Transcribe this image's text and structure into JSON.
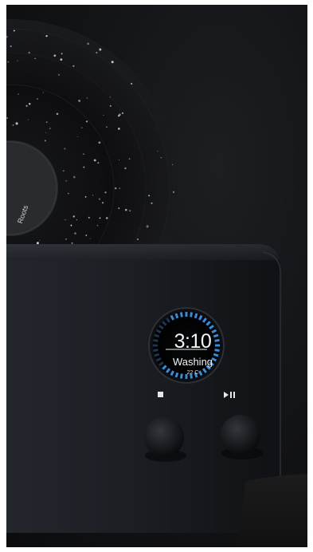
{
  "display": {
    "time": "3:10",
    "mode": "Washing",
    "temperature": "22 C",
    "progress_ring_color": "#2f8fe0",
    "progress_ring_dim_color": "#1d3550"
  },
  "record_label": {
    "artist_text": "Roots"
  },
  "controls": {
    "left_icon": "stop-icon",
    "right_icon": "play-pause-icon"
  },
  "colors": {
    "background": "#121315",
    "device_body": "#1a1d22",
    "vinyl": "#0c0c0d"
  }
}
